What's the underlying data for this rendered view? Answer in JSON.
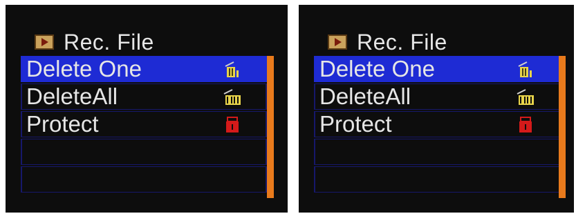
{
  "screens": [
    {
      "title": "Rec. File",
      "items": [
        {
          "label": "Delete One",
          "icon": "trash-one-icon",
          "selected": true
        },
        {
          "label": "DeleteAll",
          "icon": "trash-all-icon",
          "selected": false
        },
        {
          "label": "Protect",
          "icon": "lock-icon",
          "selected": false
        },
        {
          "label": "",
          "icon": "",
          "selected": false
        },
        {
          "label": "",
          "icon": "",
          "selected": false
        }
      ]
    },
    {
      "title": "Rec. File",
      "items": [
        {
          "label": "Delete One",
          "icon": "trash-one-icon",
          "selected": true
        },
        {
          "label": "DeleteAll",
          "icon": "trash-all-icon",
          "selected": false
        },
        {
          "label": "Protect",
          "icon": "lock-icon",
          "selected": false
        },
        {
          "label": "",
          "icon": "",
          "selected": false
        },
        {
          "label": "",
          "icon": "",
          "selected": false
        }
      ]
    }
  ],
  "colors": {
    "selected_row": "#1e2bd4",
    "scrollbar": "#e87a1c",
    "lock": "#d41a1a",
    "trash": "#e8d44a"
  }
}
